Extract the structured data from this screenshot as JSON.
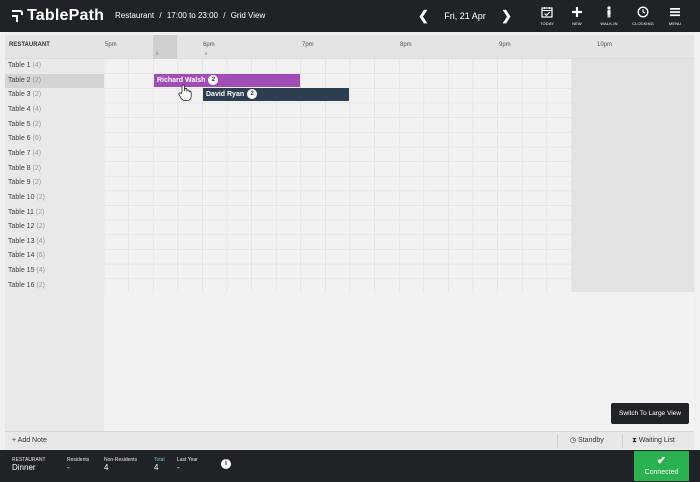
{
  "app": {
    "name": "TablePath"
  },
  "breadcrumb": {
    "venue": "Restaurant",
    "sep1": "/",
    "time_range": "17:00 to 23:00",
    "sep2": "/",
    "view": "Grid View"
  },
  "date_nav": {
    "prev": "❮",
    "date": "Fri, 21 Apr",
    "next": "❯"
  },
  "toolbar": {
    "today": "TODAY",
    "new": "NEW",
    "walkin": "WALK-IN",
    "clocking": "CLOCKING",
    "menu": "MENU"
  },
  "grid": {
    "header": "RESTAURANT",
    "times": [
      "5pm",
      "6pm",
      "7pm",
      "8pm",
      "9pm",
      "10pm"
    ],
    "slot_counts": [
      "2",
      "2"
    ],
    "tables": [
      {
        "name": "Table 1",
        "cap": "(4)"
      },
      {
        "name": "Table 2",
        "cap": "(2)"
      },
      {
        "name": "Table 3",
        "cap": "(2)"
      },
      {
        "name": "Table 4",
        "cap": "(4)"
      },
      {
        "name": "Table 5",
        "cap": "(2)"
      },
      {
        "name": "Table 6",
        "cap": "(6)"
      },
      {
        "name": "Table 7",
        "cap": "(4)"
      },
      {
        "name": "Table 8",
        "cap": "(2)"
      },
      {
        "name": "Table 9",
        "cap": "(2)"
      },
      {
        "name": "Table 10",
        "cap": "(2)"
      },
      {
        "name": "Table 11",
        "cap": "(2)"
      },
      {
        "name": "Table 12",
        "cap": "(2)"
      },
      {
        "name": "Table 13",
        "cap": "(4)"
      },
      {
        "name": "Table 14",
        "cap": "(6)"
      },
      {
        "name": "Table 15",
        "cap": "(4)"
      },
      {
        "name": "Table 16",
        "cap": "(2)"
      }
    ],
    "bookings": [
      {
        "guest": "Richard Walsh",
        "covers": "2",
        "color": "#a24db5"
      },
      {
        "guest": "David Ryan",
        "covers": "2",
        "color": "#2c3e50"
      }
    ]
  },
  "switch_view": "Switch To Large View",
  "footer": {
    "add_note": "+ Add Note",
    "standby": "Standby",
    "waiting_list": "Waiting List"
  },
  "summary": {
    "section": "RESTAURANT",
    "service": "Dinner",
    "residents_label": "Residents",
    "residents_value": "-",
    "nonresidents_label": "Non-Residents",
    "nonresidents_value": "4",
    "total_label": "Total",
    "total_value": "4",
    "lastyear_label": "Last Year",
    "lastyear_value": "-",
    "info": "i"
  },
  "status": {
    "label": "Connected",
    "color": "#29b24f"
  }
}
